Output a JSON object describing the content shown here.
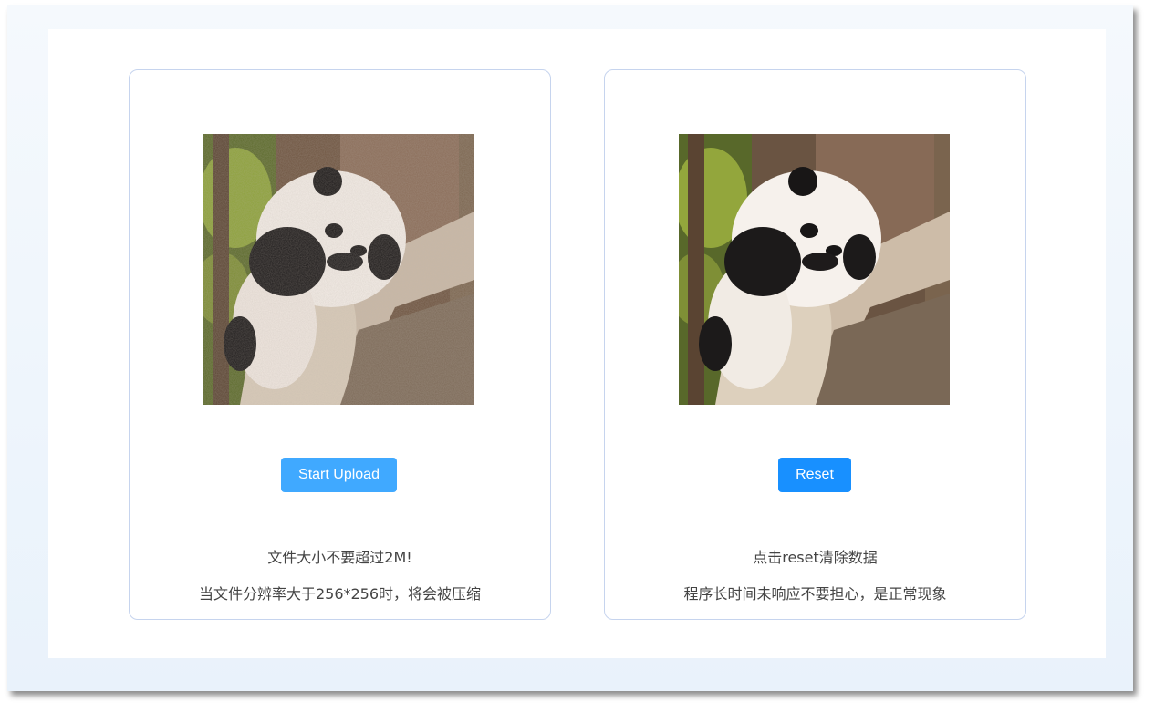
{
  "upload_card": {
    "button_label": "Start Upload",
    "note_size": "文件大小不要超过2M!",
    "note_resolution": "当文件分辨率大于256*256时，将会被压缩"
  },
  "result_card": {
    "button_label": "Reset",
    "note_reset": "点击reset清除数据",
    "note_wait": "程序长时间未响应不要担心，是正常现象"
  },
  "colors": {
    "upload_button": "#40a9ff",
    "reset_button": "#1890ff",
    "card_border": "#c6d4ee",
    "background_gradient_top": "#f5f9fd",
    "background_gradient_bottom": "#e9f2fb"
  },
  "images": {
    "input_image": "panda-on-branch-noisy",
    "output_image": "panda-on-branch-denoised"
  }
}
